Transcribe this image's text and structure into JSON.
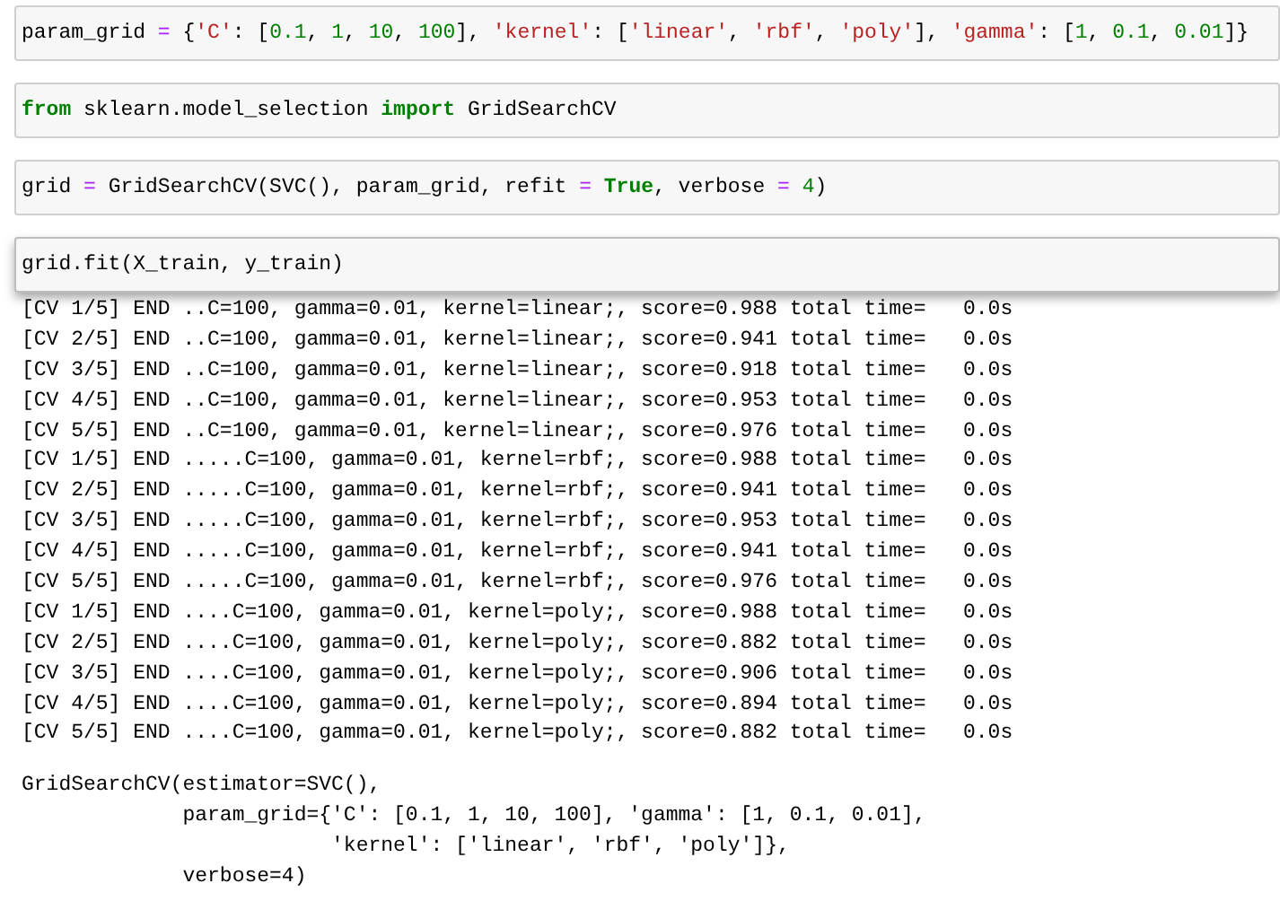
{
  "cells": [
    {
      "selected": false,
      "tokens": [
        {
          "kind": "name",
          "text": "param_grid "
        },
        {
          "kind": "op",
          "text": "="
        },
        {
          "kind": "name",
          "text": " {"
        },
        {
          "kind": "string",
          "text": "'C'"
        },
        {
          "kind": "name",
          "text": ": ["
        },
        {
          "kind": "number",
          "text": "0.1"
        },
        {
          "kind": "name",
          "text": ", "
        },
        {
          "kind": "number",
          "text": "1"
        },
        {
          "kind": "name",
          "text": ", "
        },
        {
          "kind": "number",
          "text": "10"
        },
        {
          "kind": "name",
          "text": ", "
        },
        {
          "kind": "number",
          "text": "100"
        },
        {
          "kind": "name",
          "text": "], "
        },
        {
          "kind": "string",
          "text": "'kernel'"
        },
        {
          "kind": "name",
          "text": ": ["
        },
        {
          "kind": "string",
          "text": "'linear'"
        },
        {
          "kind": "name",
          "text": ", "
        },
        {
          "kind": "string",
          "text": "'rbf'"
        },
        {
          "kind": "name",
          "text": ", "
        },
        {
          "kind": "string",
          "text": "'poly'"
        },
        {
          "kind": "name",
          "text": "], "
        },
        {
          "kind": "string",
          "text": "'gamma'"
        },
        {
          "kind": "name",
          "text": ": ["
        },
        {
          "kind": "number",
          "text": "1"
        },
        {
          "kind": "name",
          "text": ", "
        },
        {
          "kind": "number",
          "text": "0.1"
        },
        {
          "kind": "name",
          "text": ", "
        },
        {
          "kind": "number",
          "text": "0.01"
        },
        {
          "kind": "name",
          "text": "]}"
        }
      ]
    },
    {
      "selected": false,
      "tokens": [
        {
          "kind": "keyword",
          "text": "from"
        },
        {
          "kind": "name",
          "text": " sklearn.model_selection "
        },
        {
          "kind": "keyword",
          "text": "import"
        },
        {
          "kind": "name",
          "text": " GridSearchCV"
        }
      ]
    },
    {
      "selected": false,
      "tokens": [
        {
          "kind": "name",
          "text": "grid "
        },
        {
          "kind": "op",
          "text": "="
        },
        {
          "kind": "name",
          "text": " GridSearchCV(SVC(), param_grid, refit "
        },
        {
          "kind": "op",
          "text": "= "
        },
        {
          "kind": "keyword",
          "text": "True"
        },
        {
          "kind": "name",
          "text": ", verbose "
        },
        {
          "kind": "op",
          "text": "= "
        },
        {
          "kind": "number",
          "text": "4"
        },
        {
          "kind": "name",
          "text": ")"
        }
      ]
    },
    {
      "selected": true,
      "tokens": [
        {
          "kind": "name",
          "text": "grid.fit(X_train, y_train)"
        }
      ]
    }
  ],
  "log_lines": [
    "[CV 1/5] END ..C=100, gamma=0.01, kernel=linear;, score=0.988 total time=   0.0s",
    "[CV 2/5] END ..C=100, gamma=0.01, kernel=linear;, score=0.941 total time=   0.0s",
    "[CV 3/5] END ..C=100, gamma=0.01, kernel=linear;, score=0.918 total time=   0.0s",
    "[CV 4/5] END ..C=100, gamma=0.01, kernel=linear;, score=0.953 total time=   0.0s",
    "[CV 5/5] END ..C=100, gamma=0.01, kernel=linear;, score=0.976 total time=   0.0s",
    "[CV 1/5] END .....C=100, gamma=0.01, kernel=rbf;, score=0.988 total time=   0.0s",
    "[CV 2/5] END .....C=100, gamma=0.01, kernel=rbf;, score=0.941 total time=   0.0s",
    "[CV 3/5] END .....C=100, gamma=0.01, kernel=rbf;, score=0.953 total time=   0.0s",
    "[CV 4/5] END .....C=100, gamma=0.01, kernel=rbf;, score=0.941 total time=   0.0s",
    "[CV 5/5] END .....C=100, gamma=0.01, kernel=rbf;, score=0.976 total time=   0.0s",
    "[CV 1/5] END ....C=100, gamma=0.01, kernel=poly;, score=0.988 total time=   0.0s",
    "[CV 2/5] END ....C=100, gamma=0.01, kernel=poly;, score=0.882 total time=   0.0s",
    "[CV 3/5] END ....C=100, gamma=0.01, kernel=poly;, score=0.906 total time=   0.0s",
    "[CV 4/5] END ....C=100, gamma=0.01, kernel=poly;, score=0.894 total time=   0.0s",
    "[CV 5/5] END ....C=100, gamma=0.01, kernel=poly;, score=0.882 total time=   0.0s"
  ],
  "result_lines": [
    "GridSearchCV(estimator=SVC(),",
    "             param_grid={'C': [0.1, 1, 10, 100], 'gamma': [1, 0.1, 0.01],",
    "                         'kernel': ['linear', 'rbf', 'poly']},",
    "             verbose=4)"
  ]
}
